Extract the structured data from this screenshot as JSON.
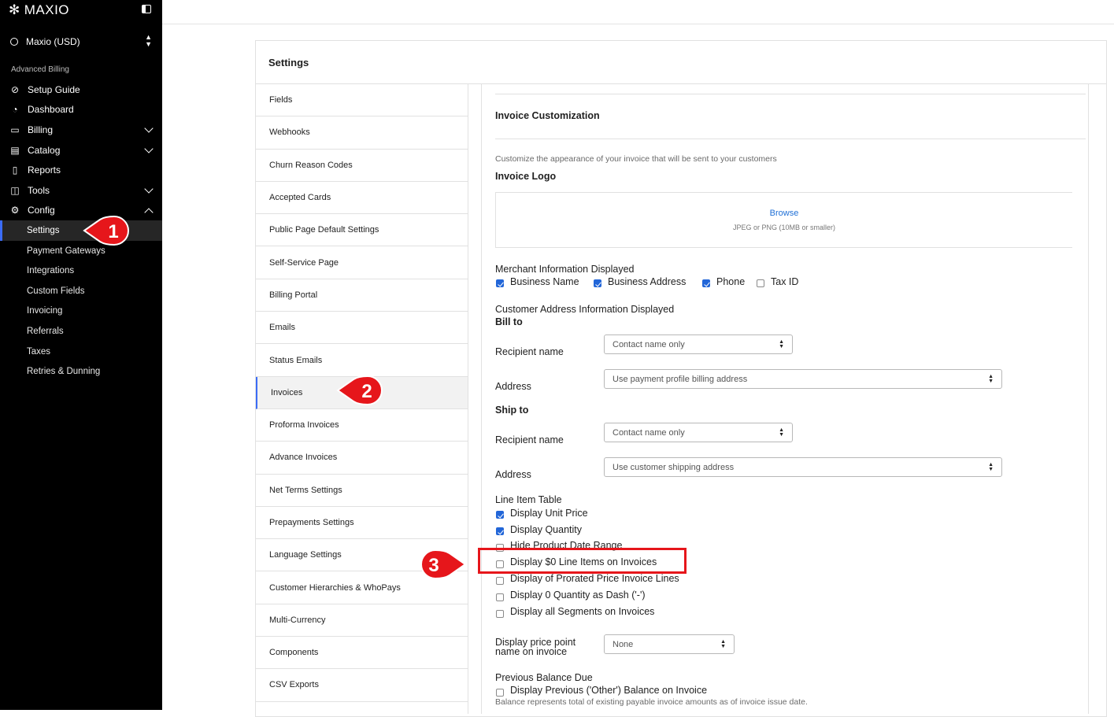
{
  "brand": {
    "name": "MAXIO"
  },
  "org": {
    "name": "Maxio (USD)"
  },
  "sidebar": {
    "section_label": "Advanced Billing",
    "items": [
      {
        "label": "Setup Guide",
        "icon": "check-circle-icon"
      },
      {
        "label": "Dashboard",
        "icon": "gauge-icon"
      },
      {
        "label": "Billing",
        "icon": "card-icon",
        "chevron": "down"
      },
      {
        "label": "Catalog",
        "icon": "book-icon",
        "chevron": "down"
      },
      {
        "label": "Reports",
        "icon": "clipboard-icon"
      },
      {
        "label": "Tools",
        "icon": "briefcase-icon",
        "chevron": "down"
      },
      {
        "label": "Config",
        "icon": "gear-icon",
        "chevron": "up"
      }
    ],
    "config_items": [
      "Settings",
      "Payment Gateways",
      "Integrations",
      "Custom Fields",
      "Invoicing",
      "Referrals",
      "Taxes",
      "Retries & Dunning"
    ]
  },
  "settings": {
    "title": "Settings",
    "menu": [
      "Fields",
      "Webhooks",
      "Churn Reason Codes",
      "Accepted Cards",
      "Public Page Default Settings",
      "Self-Service Page",
      "Billing Portal",
      "Emails",
      "Status Emails",
      "Invoices",
      "Proforma Invoices",
      "Advance Invoices",
      "Net Terms Settings",
      "Prepayments Settings",
      "Language Settings",
      "Customer Hierarchies & WhoPays",
      "Multi-Currency",
      "Components",
      "CSV Exports"
    ]
  },
  "invoice": {
    "title": "Invoice Customization",
    "description": "Customize the appearance of your invoice that will be sent to your customers",
    "logo_label": "Invoice Logo",
    "browse": "Browse",
    "logo_hint": "JPEG or PNG (10MB or smaller)",
    "merchant_label": "Merchant Information Displayed",
    "merchant_options": [
      {
        "label": "Business Name",
        "checked": true
      },
      {
        "label": "Business Address",
        "checked": true
      },
      {
        "label": "Phone",
        "checked": true
      },
      {
        "label": "Tax ID",
        "checked": false
      }
    ],
    "customer_label": "Customer Address Information Displayed",
    "bill_to": "Bill to",
    "ship_to": "Ship to",
    "recipient_label": "Recipient name",
    "address_label": "Address",
    "bill_recipient": "Contact name only",
    "bill_address": "Use payment profile billing address",
    "ship_recipient": "Contact name only",
    "ship_address": "Use customer shipping address",
    "line_table_label": "Line Item Table",
    "line_options": [
      {
        "label": "Display Unit Price",
        "checked": true
      },
      {
        "label": "Display Quantity",
        "checked": true
      },
      {
        "label": "Hide Product Date Range",
        "checked": false
      },
      {
        "label": "Display $0 Line Items on Invoices",
        "checked": false
      },
      {
        "label": "Display of Prorated Price Invoice Lines",
        "checked": false
      },
      {
        "label": "Display 0 Quantity as Dash ('-')",
        "checked": false
      },
      {
        "label": "Display all Segments on Invoices",
        "checked": false
      }
    ],
    "price_point_label_1": "Display price point",
    "price_point_label_2": "name on invoice",
    "price_point_value": "None",
    "prev_balance_label": "Previous Balance Due",
    "prev_balance_option": "Display Previous ('Other') Balance on Invoice",
    "prev_balance_note": "Balance represents total of existing payable invoice amounts as of invoice issue date."
  },
  "annotations": {
    "step1": "1",
    "step2": "2",
    "step3": "3",
    "color": "#e6161b"
  }
}
